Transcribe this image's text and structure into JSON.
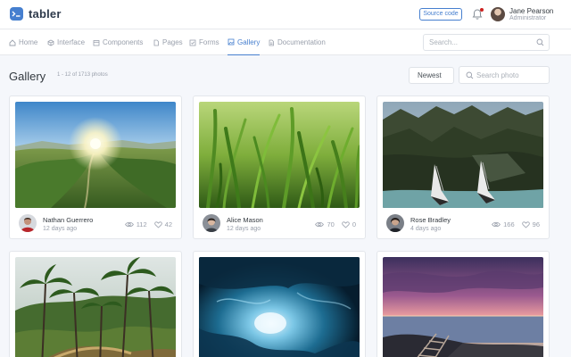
{
  "header": {
    "logo_text": "tabler",
    "source_button": "Source code",
    "user": {
      "name": "Jane Pearson",
      "role": "Administrator"
    }
  },
  "nav": {
    "items": [
      {
        "label": "Home",
        "icon": "home-icon"
      },
      {
        "label": "Interface",
        "icon": "box-icon"
      },
      {
        "label": "Components",
        "icon": "calendar-icon"
      },
      {
        "label": "Pages",
        "icon": "file-icon"
      },
      {
        "label": "Forms",
        "icon": "check-square-icon"
      },
      {
        "label": "Gallery",
        "icon": "image-icon",
        "active": true
      },
      {
        "label": "Documentation",
        "icon": "file-text-icon"
      }
    ],
    "search_placeholder": "Search..."
  },
  "page": {
    "title": "Gallery",
    "subtitle": "1 - 12 of 1713 photos",
    "sort_value": "Newest",
    "search_placeholder": "Search photo"
  },
  "cards": [
    {
      "author": "Nathan Guerrero",
      "time": "12 days ago",
      "views": "112",
      "likes": "42",
      "photo": "mountain-sunrise-valley"
    },
    {
      "author": "Alice Mason",
      "time": "12 days ago",
      "views": "70",
      "likes": "0",
      "photo": "green-grass-closeup"
    },
    {
      "author": "Rose Bradley",
      "time": "4 days ago",
      "views": "166",
      "likes": "96",
      "photo": "feet-over-cliff"
    },
    {
      "photo": "tropical-palm-forest"
    },
    {
      "photo": "ice-cave"
    },
    {
      "photo": "sunset-boardwalk-coast"
    }
  ],
  "colors": {
    "accent": "#467fcf",
    "notification": "#cd201f"
  }
}
